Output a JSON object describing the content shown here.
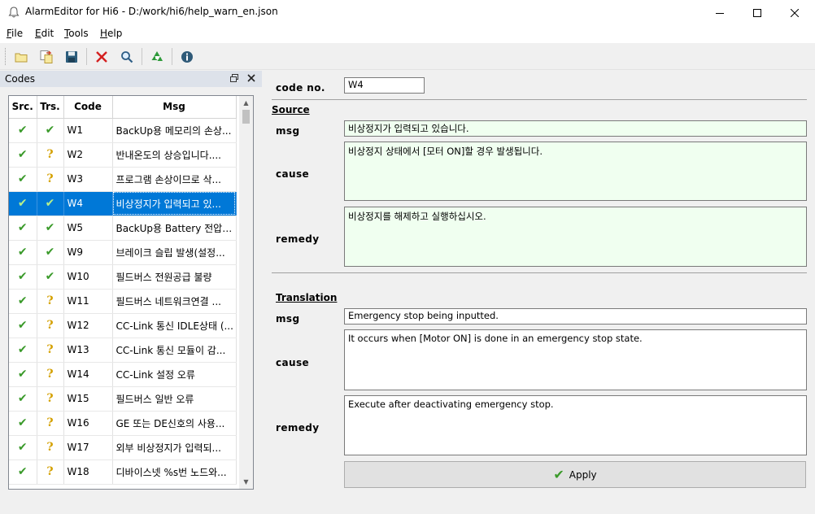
{
  "window": {
    "title": "AlarmEditor for Hi6 - D:/work/hi6/help_warn_en.json"
  },
  "menu": [
    {
      "key": "F",
      "rest": "ile"
    },
    {
      "key": "E",
      "rest": "dit"
    },
    {
      "key": "T",
      "rest": "ools"
    },
    {
      "key": "H",
      "rest": "elp"
    }
  ],
  "toolbar": {
    "icons": [
      "open-folder-icon",
      "copy-icon",
      "save-icon",
      "delete-icon",
      "search-icon",
      "recycle-icon",
      "info-icon"
    ]
  },
  "codes_panel": {
    "title": "Codes",
    "columns": [
      "Src.",
      "Trs.",
      "Code",
      "Msg"
    ],
    "rows": [
      {
        "src": "check",
        "trs": "check",
        "code": "W1",
        "msg": "BackUp용 메모리의 손상..."
      },
      {
        "src": "check",
        "trs": "question",
        "code": "W2",
        "msg": "반내온도의 상승입니다...."
      },
      {
        "src": "check",
        "trs": "question",
        "code": "W3",
        "msg": "프로그램 손상이므로 삭..."
      },
      {
        "src": "check",
        "trs": "check",
        "code": "W4",
        "msg": "비상정지가 입력되고 있...",
        "selected": true
      },
      {
        "src": "check",
        "trs": "check",
        "code": "W5",
        "msg": "BackUp용 Battery 전압저..."
      },
      {
        "src": "check",
        "trs": "check",
        "code": "W9",
        "msg": "브레이크 슬립 발생(설정..."
      },
      {
        "src": "check",
        "trs": "check",
        "code": "W10",
        "msg": "필드버스 전원공급 불량"
      },
      {
        "src": "check",
        "trs": "question",
        "code": "W11",
        "msg": "필드버스 네트워크연결 ..."
      },
      {
        "src": "check",
        "trs": "question",
        "code": "W12",
        "msg": "CC-Link 통신 IDLE상태 (..."
      },
      {
        "src": "check",
        "trs": "question",
        "code": "W13",
        "msg": "CC-Link 통신 모듈이 감..."
      },
      {
        "src": "check",
        "trs": "question",
        "code": "W14",
        "msg": "CC-Link 설정 오류"
      },
      {
        "src": "check",
        "trs": "question",
        "code": "W15",
        "msg": "필드버스 일반 오류"
      },
      {
        "src": "check",
        "trs": "question",
        "code": "W16",
        "msg": "GE 또는 DE신호의 사용..."
      },
      {
        "src": "check",
        "trs": "question",
        "code": "W17",
        "msg": "외부 비상정지가 입력되..."
      },
      {
        "src": "check",
        "trs": "question",
        "code": "W18",
        "msg": "디바이스넷 %s번 노드와..."
      }
    ]
  },
  "detail": {
    "code_no_label": "code no.",
    "code_no_value": "W4",
    "source_title": "Source",
    "translation_title": "Translation",
    "msg_label": "msg",
    "cause_label": "cause",
    "remedy_label": "remedy",
    "source": {
      "msg": "비상정지가 입력되고 있습니다.",
      "cause": "비상정지 상태에서 [모터 ON]할 경우 발생됩니다.",
      "remedy": "비상정지를 해제하고 실행하십시오."
    },
    "translation": {
      "msg": "Emergency stop being inputted.",
      "cause": "It occurs when [Motor ON] is done in an emergency stop state.",
      "remedy": "Execute after deactivating emergency stop."
    },
    "apply_label": "Apply"
  },
  "colors": {
    "selection": "#0078d7",
    "check": "#3a9a2a",
    "question": "#d4a000",
    "source_bg": "#f0fff0",
    "panel_header": "#dde2ea"
  }
}
